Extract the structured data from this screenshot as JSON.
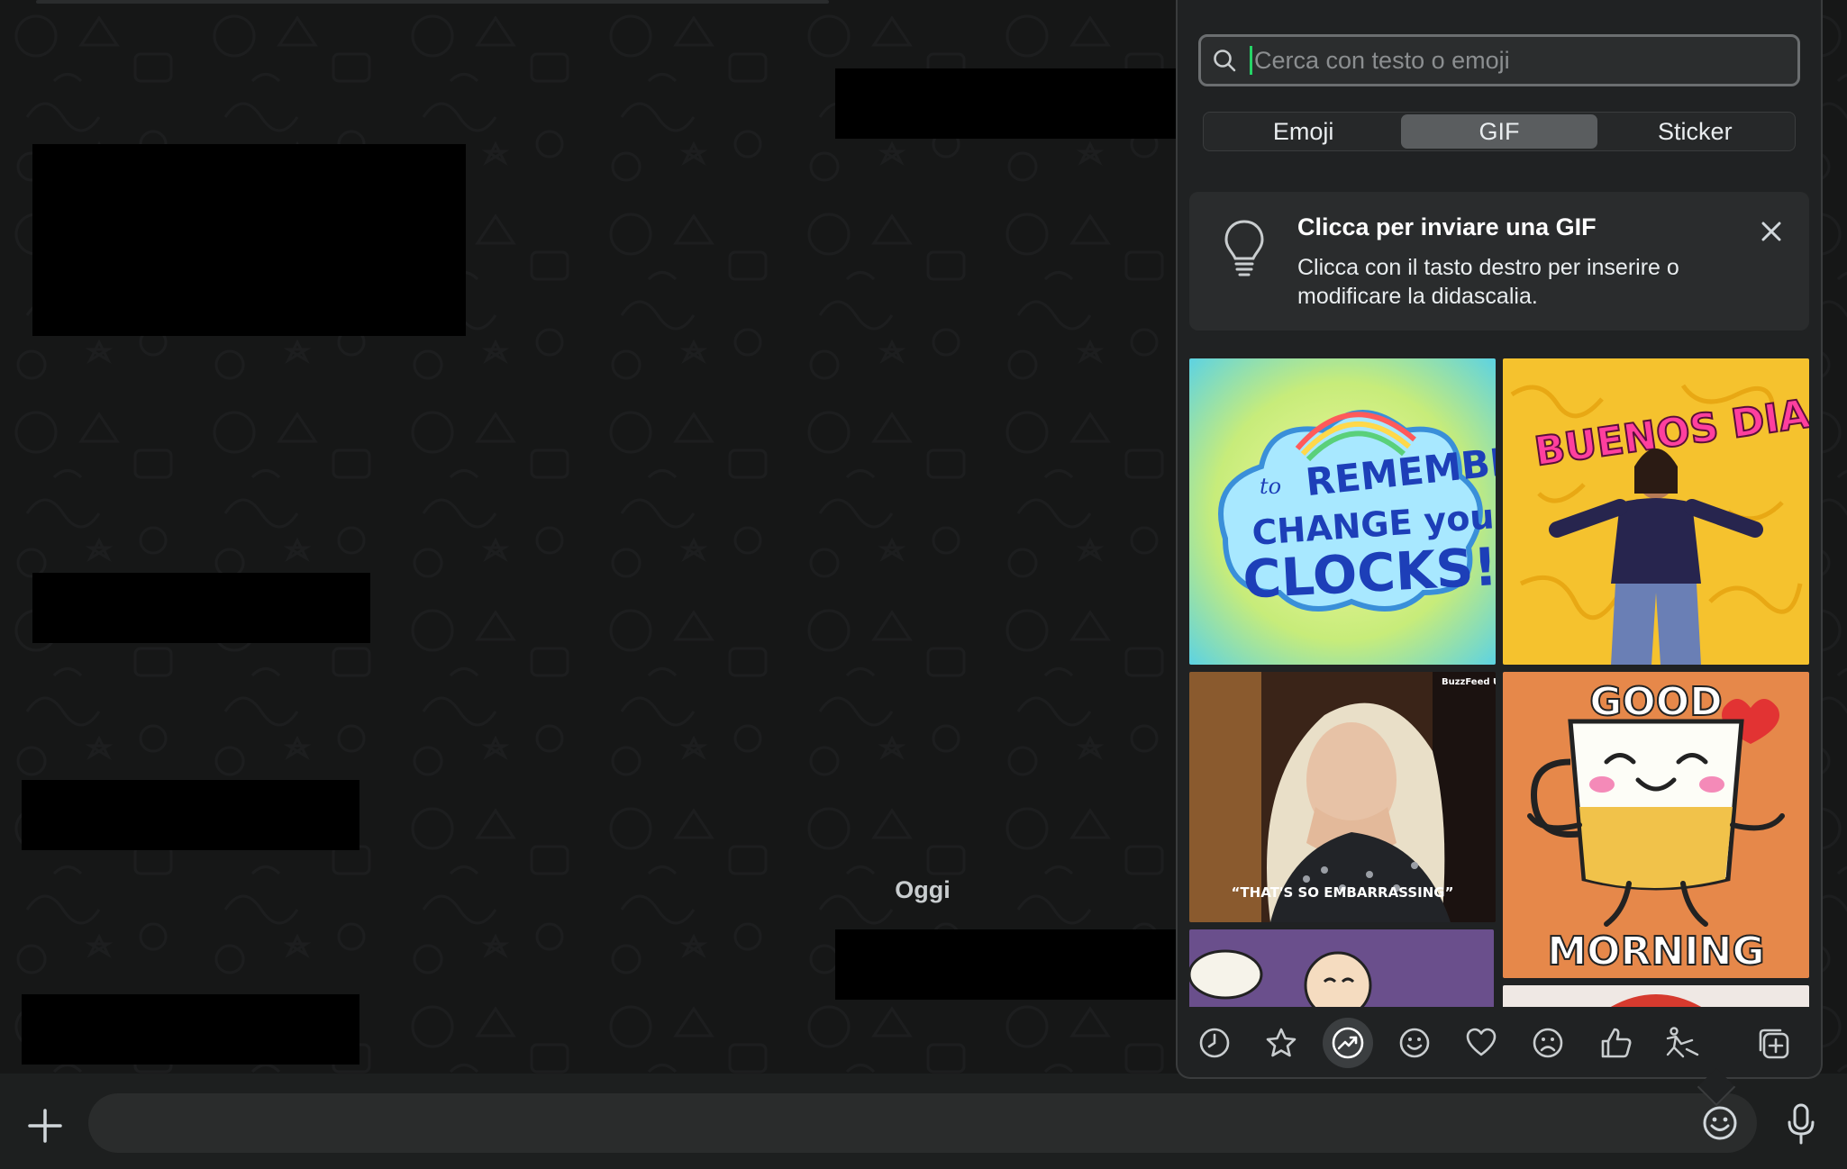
{
  "chat": {
    "date_label": "Oggi"
  },
  "composer": {
    "placeholder": "",
    "icons": {
      "attach": "plus-icon",
      "emoji": "emoji-icon",
      "voice": "microphone-icon"
    }
  },
  "picker": {
    "search": {
      "placeholder": "Cerca con testo o emoji"
    },
    "tabs": [
      {
        "label": "Emoji",
        "active": false
      },
      {
        "label": "GIF",
        "active": true
      },
      {
        "label": "Sticker",
        "active": false
      }
    ],
    "tip": {
      "title": "Clicca per inviare una GIF",
      "body": "Clicca con il tasto destro per inserire o modificare la didascalia."
    },
    "gifs": [
      {
        "text_lines": [
          "to",
          "REMEMBER",
          "CHANGE your",
          "CLOCKS!"
        ]
      },
      {
        "text": "BUENOS DIAS!"
      },
      {
        "text": "“THAT'S SO EMBARRASSING”",
        "badge": "BuzzFeed UK"
      },
      {
        "text_top": "GOOD",
        "text_bottom": "MORNING"
      },
      {
        "text": ""
      },
      {
        "text": ""
      }
    ],
    "categories": [
      {
        "icon": "clock-icon",
        "active": false
      },
      {
        "icon": "star-icon",
        "active": false
      },
      {
        "icon": "trending-icon",
        "active": true
      },
      {
        "icon": "smile-icon",
        "active": false
      },
      {
        "icon": "heart-icon",
        "active": false
      },
      {
        "icon": "sad-icon",
        "active": false
      },
      {
        "icon": "thumbs-up-icon",
        "active": false
      },
      {
        "icon": "dance-icon",
        "active": false
      },
      {
        "icon": "add-sticker-icon",
        "active": false
      }
    ]
  },
  "colors": {
    "accent": "#25d366",
    "panel": "#202223",
    "chat_bg": "#161717"
  }
}
